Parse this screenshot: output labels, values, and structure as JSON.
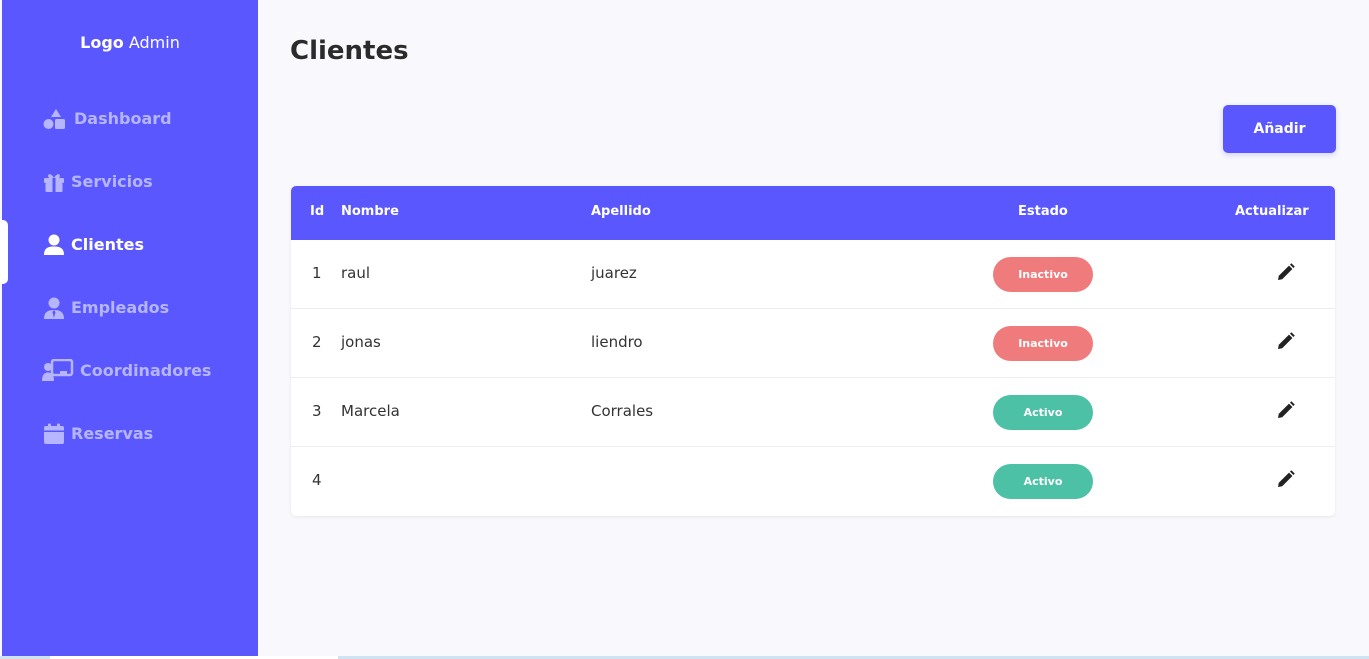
{
  "brand": {
    "logo_bold": "Logo",
    "logo_rest": "Admin"
  },
  "sidebar": {
    "items": [
      {
        "label": "Dashboard",
        "icon": "shapes-icon",
        "active": false
      },
      {
        "label": "Servicios",
        "icon": "gift-icon",
        "active": false
      },
      {
        "label": "Clientes",
        "icon": "user-icon",
        "active": true
      },
      {
        "label": "Empleados",
        "icon": "user-tie-icon",
        "active": false
      },
      {
        "label": "Coordinadores",
        "icon": "chalkboard-user-icon",
        "active": false
      },
      {
        "label": "Reservas",
        "icon": "calendar-icon",
        "active": false
      }
    ]
  },
  "page": {
    "title": "Clientes",
    "add_label": "Añadir"
  },
  "table": {
    "columns": {
      "id": "Id",
      "nombre": "Nombre",
      "apellido": "Apellido",
      "estado": "Estado",
      "actualizar": "Actualizar"
    },
    "rows": [
      {
        "id": "1",
        "nombre": "raul",
        "apellido": "juarez",
        "estado": "Inactivo",
        "status": "inactive"
      },
      {
        "id": "2",
        "nombre": "jonas",
        "apellido": "liendro",
        "estado": "Inactivo",
        "status": "inactive"
      },
      {
        "id": "3",
        "nombre": "Marcela",
        "apellido": "Corrales",
        "estado": "Activo",
        "status": "active"
      },
      {
        "id": "4",
        "nombre": "",
        "apellido": "",
        "estado": "Activo",
        "status": "active"
      }
    ]
  },
  "colors": {
    "accent": "#5a57ff",
    "sidebar_label": "#b6b5ff",
    "inactive_badge": "#f07b7c",
    "active_badge": "#4dc1a6"
  }
}
